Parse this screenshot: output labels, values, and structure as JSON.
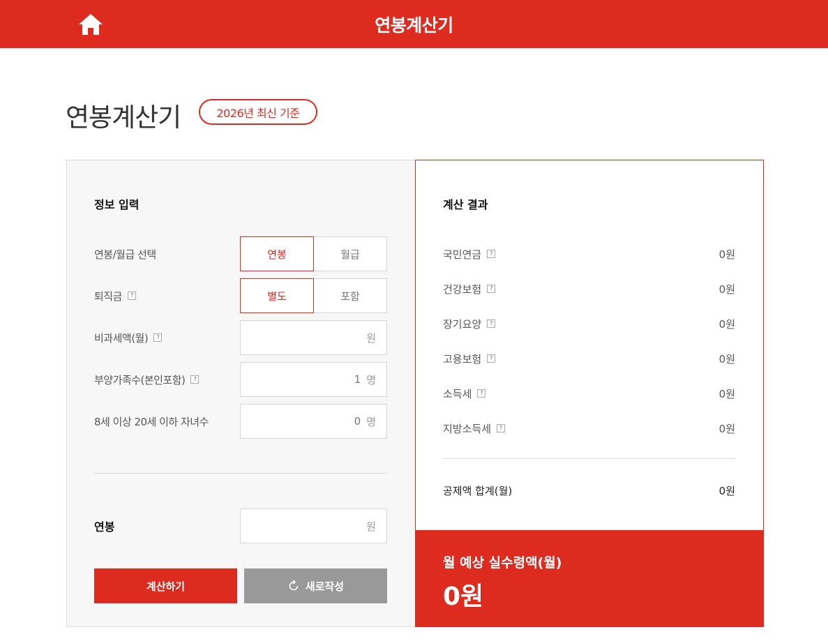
{
  "header": {
    "title": "연봉계산기",
    "home_icon": "home-icon"
  },
  "page": {
    "title": "연봉계산기",
    "badge": "2026년 최신 기준"
  },
  "colors": {
    "accent": "#dd2b1f",
    "gray_button": "#999999",
    "panel_bg": "#f7f7f7"
  },
  "input": {
    "section_title": "정보 입력",
    "salary_type": {
      "label": "연봉/월급 선택",
      "options": [
        "연봉",
        "월급"
      ],
      "selected": "연봉"
    },
    "severance": {
      "label": "퇴직금",
      "options": [
        "별도",
        "포함"
      ],
      "selected": "별도"
    },
    "nontaxable": {
      "label": "비과세액(월)",
      "value": "",
      "unit": "원"
    },
    "dependents": {
      "label": "부양가족수(본인포함)",
      "value": "1",
      "unit": "명"
    },
    "children": {
      "label": "8세 이상 20세 이하 자녀수",
      "value": "0",
      "unit": "명"
    },
    "salary": {
      "label": "연봉",
      "value": "",
      "unit": "원"
    },
    "calc_button": "계산하기",
    "reset_button": "새로작성",
    "help_glyph": "?"
  },
  "result": {
    "section_title": "계산 결과",
    "items": [
      {
        "label": "국민연금",
        "value": "0원"
      },
      {
        "label": "건강보험",
        "value": "0원"
      },
      {
        "label": "장기요양",
        "value": "0원"
      },
      {
        "label": "고용보험",
        "value": "0원"
      },
      {
        "label": "소득세",
        "value": "0원"
      },
      {
        "label": "지방소득세",
        "value": "0원"
      }
    ],
    "total_label": "공제액 합계(월)",
    "total_value": "0원",
    "net_label": "월 예상 실수령액(월)",
    "net_value": "0원"
  }
}
